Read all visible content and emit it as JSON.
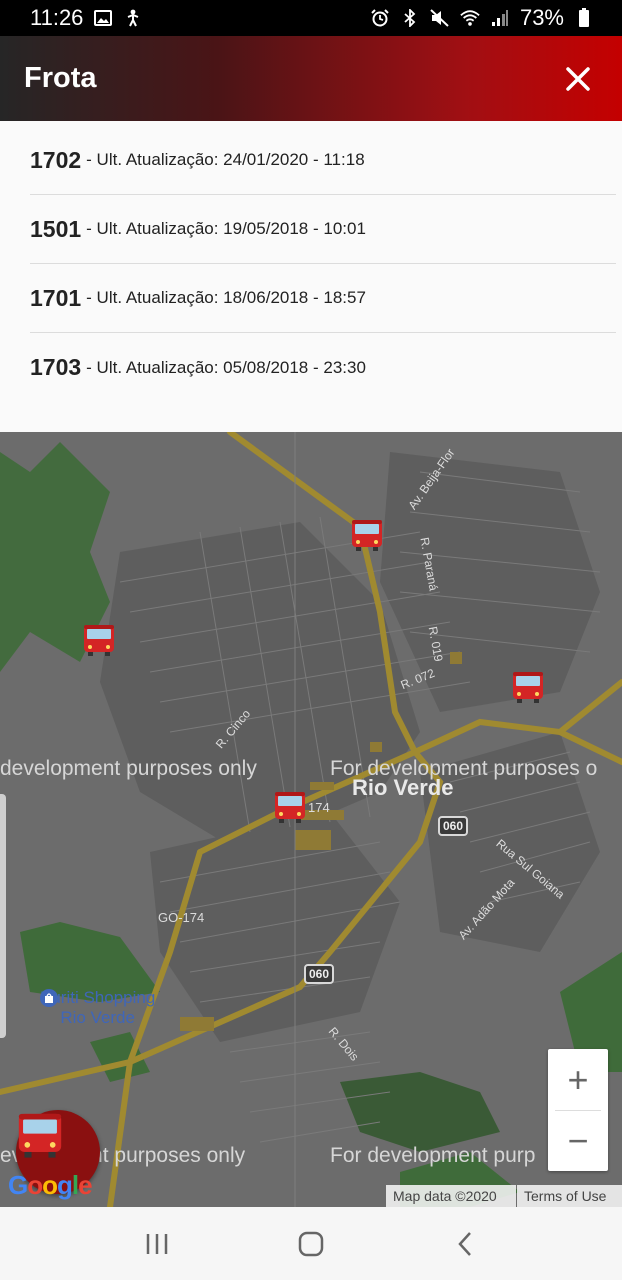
{
  "status_bar": {
    "time": "11:26",
    "battery": "73%",
    "icons_left": [
      "image-icon",
      "accessibility-icon"
    ],
    "icons_right": [
      "alarm-icon",
      "bluetooth-icon",
      "mute-icon",
      "wifi-icon",
      "signal-icon",
      "battery-icon"
    ]
  },
  "header": {
    "title": "Frota",
    "close_icon": "close-icon",
    "gradient_colors": [
      "#262626",
      "#c40000"
    ]
  },
  "vehicles": [
    {
      "id": "1702",
      "update": "- Ult. Atualização: 24/01/2020 - 11:18"
    },
    {
      "id": "1501",
      "update": "- Ult. Atualização: 19/05/2018 - 10:01"
    },
    {
      "id": "1701",
      "update": "- Ult. Atualização: 18/06/2018 - 18:57"
    },
    {
      "id": "1703",
      "update": "- Ult. Atualização: 05/08/2018 - 23:30"
    }
  ],
  "map": {
    "city": "Rio Verde",
    "dev_watermark_1": "development purposes only",
    "dev_watermark_2": "For development purposes o",
    "dev_watermark_3": "evelopment purposes only",
    "dev_watermark_4": "For development purp",
    "streets": {
      "beija_flor": "Av. Beija-Flor",
      "parana": "R. Paraná",
      "r019": "R. 019",
      "r072": "R. 072",
      "cinco": "R. Cinco",
      "sul_goiana": "Rua Sul Goiana",
      "adao_mota": "Av. Adão Mota",
      "go174": "GO-174",
      "r174": "174",
      "dois": "R. Dois"
    },
    "shields": {
      "s060a": "060",
      "s060b": "060"
    },
    "poi_line1": "Buriti Shopping",
    "poi_line2": "Rio Verde",
    "zoom_in": "+",
    "zoom_out": "−",
    "google": "Google",
    "attribution_data": "Map data ©2020",
    "attribution_terms": "Terms of Use",
    "bus_marker_icon": "bus-icon"
  },
  "nav_bar": {
    "icons": [
      "recents-icon",
      "home-icon",
      "back-icon"
    ]
  }
}
